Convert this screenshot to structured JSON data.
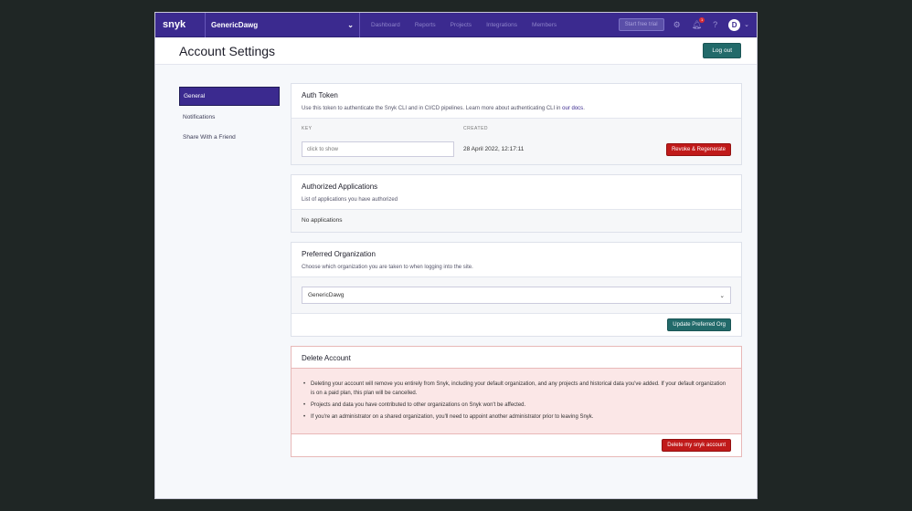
{
  "nav": {
    "logo": "snyk",
    "org": "GenericDawg",
    "links": [
      "Dashboard",
      "Reports",
      "Projects",
      "Integrations",
      "Members"
    ],
    "trial_label": "Start free trial",
    "notification_count": "1",
    "avatar_initial": "D"
  },
  "header": {
    "title": "Account Settings",
    "logout_label": "Log out"
  },
  "sidebar": {
    "items": [
      {
        "label": "General",
        "active": true
      },
      {
        "label": "Notifications",
        "active": false
      },
      {
        "label": "Share With a Friend",
        "active": false
      }
    ]
  },
  "auth_token": {
    "title": "Auth Token",
    "desc_prefix": "Use this token to authenticate the Snyk CLI and in CI/CD pipelines. Learn more about authenticating CLI in ",
    "desc_link": "our docs",
    "desc_suffix": ".",
    "key_header": "KEY",
    "created_header": "CREATED",
    "key_placeholder": "click to show",
    "created_value": "28 April 2022, 12:17:11",
    "revoke_label": "Revoke & Regenerate"
  },
  "authorized_apps": {
    "title": "Authorized Applications",
    "desc": "List of applications you have authorized",
    "empty_text": "No applications"
  },
  "preferred_org": {
    "title": "Preferred Organization",
    "desc": "Choose which organization you are taken to when logging into the site.",
    "selected": "GenericDawg",
    "update_label": "Update Preferred Org"
  },
  "delete_account": {
    "title": "Delete Account",
    "bullets": [
      "Deleting your account will remove you entirely from Snyk, including your default organization, and any projects and historical data you've added. If your default organization is on a paid plan, this plan will be cancelled.",
      "Projects and data you have contributed to other organizations on Snyk won't be affected.",
      "If you're an administrator on a shared organization, you'll need to appoint another administrator prior to leaving Snyk."
    ],
    "delete_label": "Delete my snyk account"
  }
}
